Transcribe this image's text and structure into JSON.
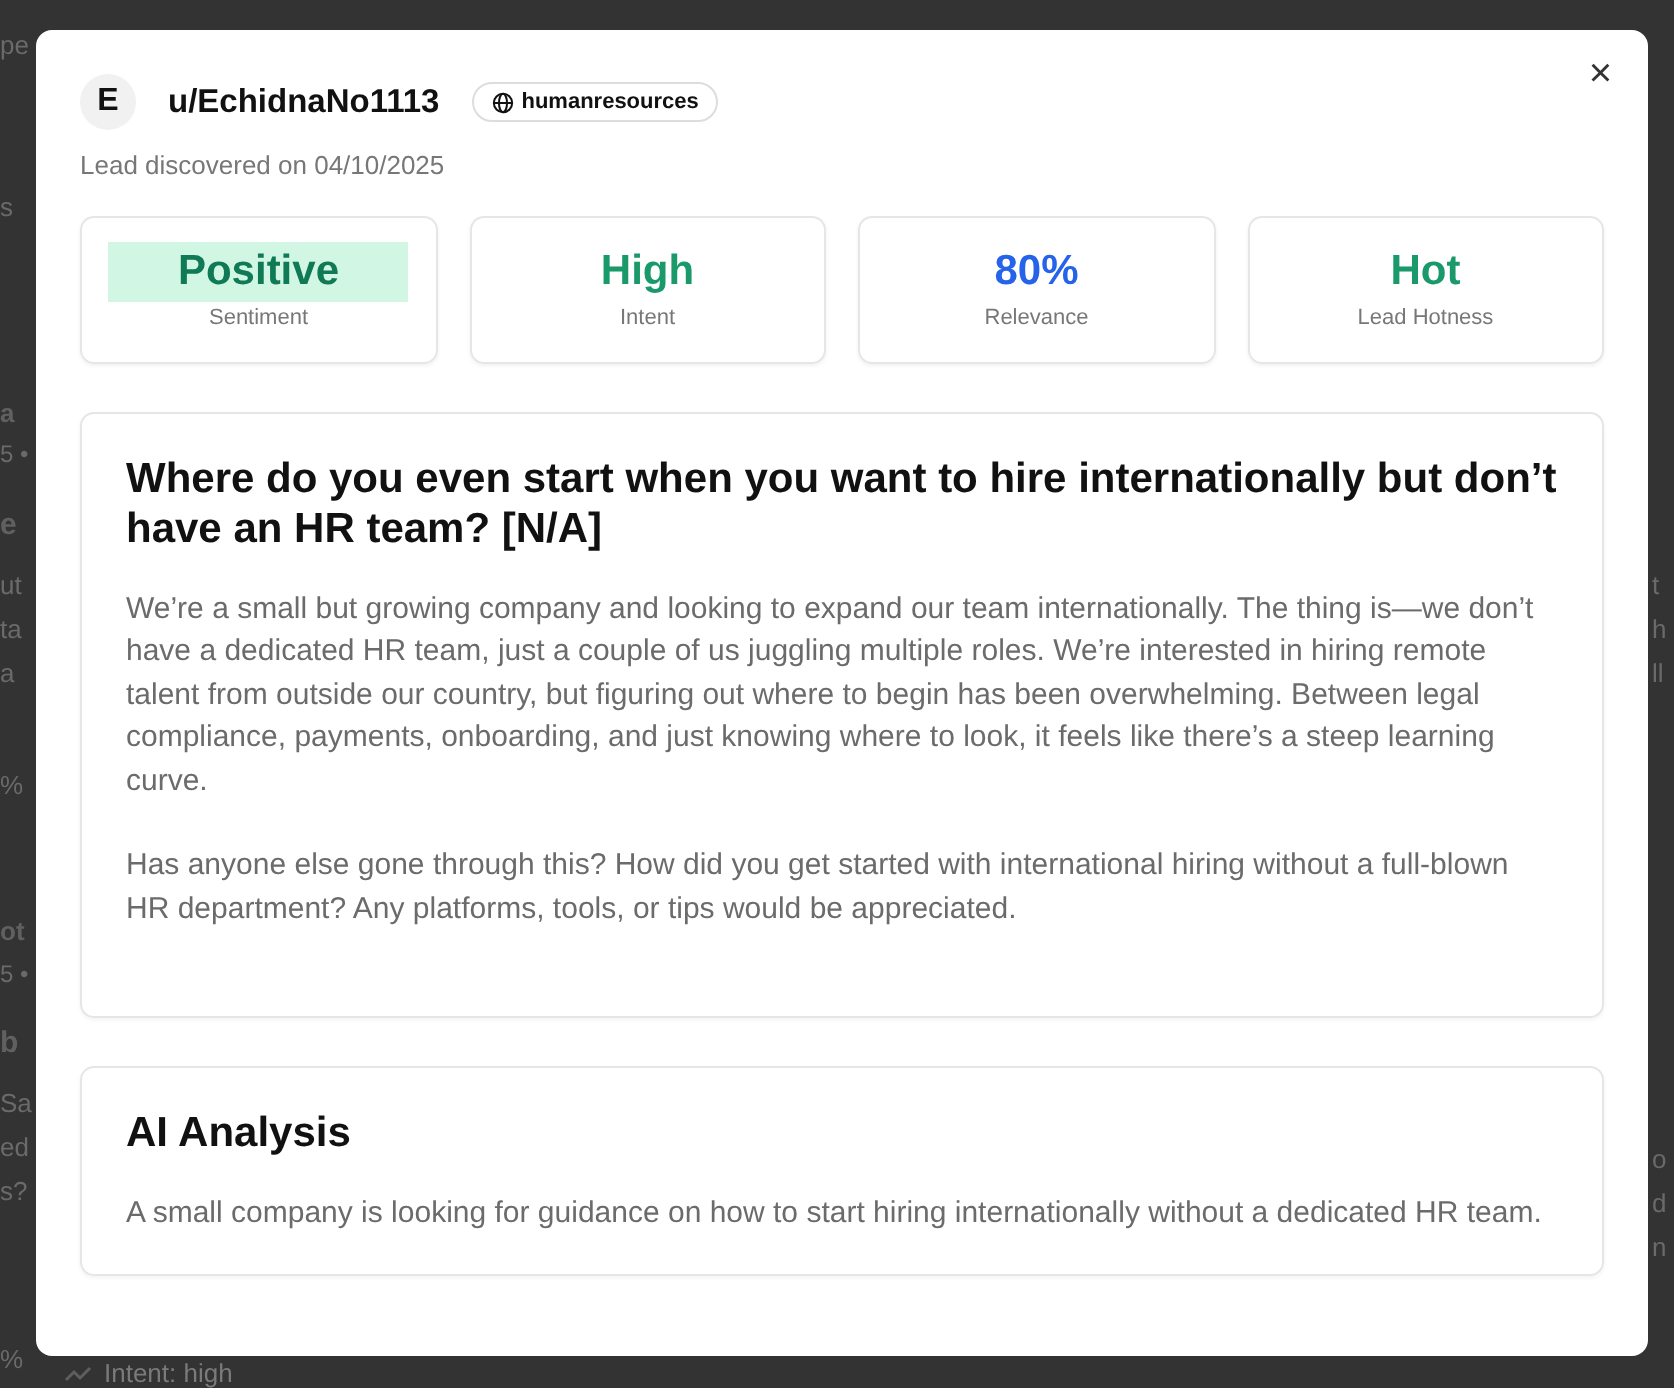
{
  "background": {
    "left_fragments": [
      {
        "text": "pe",
        "kind": "text"
      },
      {
        "text": "s",
        "kind": "text"
      },
      {
        "text": "a",
        "kind": "heading"
      },
      {
        "text": "5 •",
        "kind": "meta"
      },
      {
        "text": "e",
        "kind": "title"
      },
      {
        "text": "ut",
        "kind": "text"
      },
      {
        "text": "ta",
        "kind": "text"
      },
      {
        "text": "a",
        "kind": "text"
      },
      {
        "text": "%",
        "kind": "text"
      },
      {
        "text": "ot",
        "kind": "heading"
      },
      {
        "text": "5 •",
        "kind": "meta"
      },
      {
        "text": "b",
        "kind": "title"
      },
      {
        "text": "Sa",
        "kind": "text"
      },
      {
        "text": "ed",
        "kind": "text"
      },
      {
        "text": "s?",
        "kind": "text"
      },
      {
        "text": "%",
        "kind": "text"
      }
    ],
    "right_fragments": [
      "t",
      "h",
      "ll",
      "o",
      "d",
      "n"
    ],
    "bottom_tag": "Intent: high"
  },
  "modal": {
    "avatar": "E",
    "username": "u/EchidnaNo1113",
    "community": "humanresources",
    "close": "×",
    "discovered": "Lead discovered on 04/10/2025",
    "stats": [
      {
        "value": "Positive",
        "label": "Sentiment",
        "color": "#0f7a55",
        "highlighted": true
      },
      {
        "value": "High",
        "label": "Intent",
        "color": "#1a9a6a",
        "highlighted": false
      },
      {
        "value": "80%",
        "label": "Relevance",
        "color": "#2563eb",
        "highlighted": false
      },
      {
        "value": "Hot",
        "label": "Lead Hotness",
        "color": "#1a9a6a",
        "highlighted": false
      }
    ],
    "post": {
      "title": "Where do you even start when you want to hire internationally but don’t have an HR team? [N/A]",
      "paragraphs": [
        "We’re a small but growing company and looking to expand our team internationally. The thing is—we don’t have a dedicated HR team, just a couple of us juggling multiple roles. We’re interested in hiring remote talent from outside our country, but figuring out where to begin has been overwhelming. Between legal compliance, payments, onboarding, and just knowing where to look, it feels like there’s a steep learning curve.",
        "Has anyone else gone through this? How did you get started with international hiring without a full-blown HR department? Any platforms, tools, or tips would be appreciated."
      ]
    },
    "analysis": {
      "title": "AI Analysis",
      "text": "A small company is looking for guidance on how to start hiring internationally without a dedicated HR team."
    }
  }
}
